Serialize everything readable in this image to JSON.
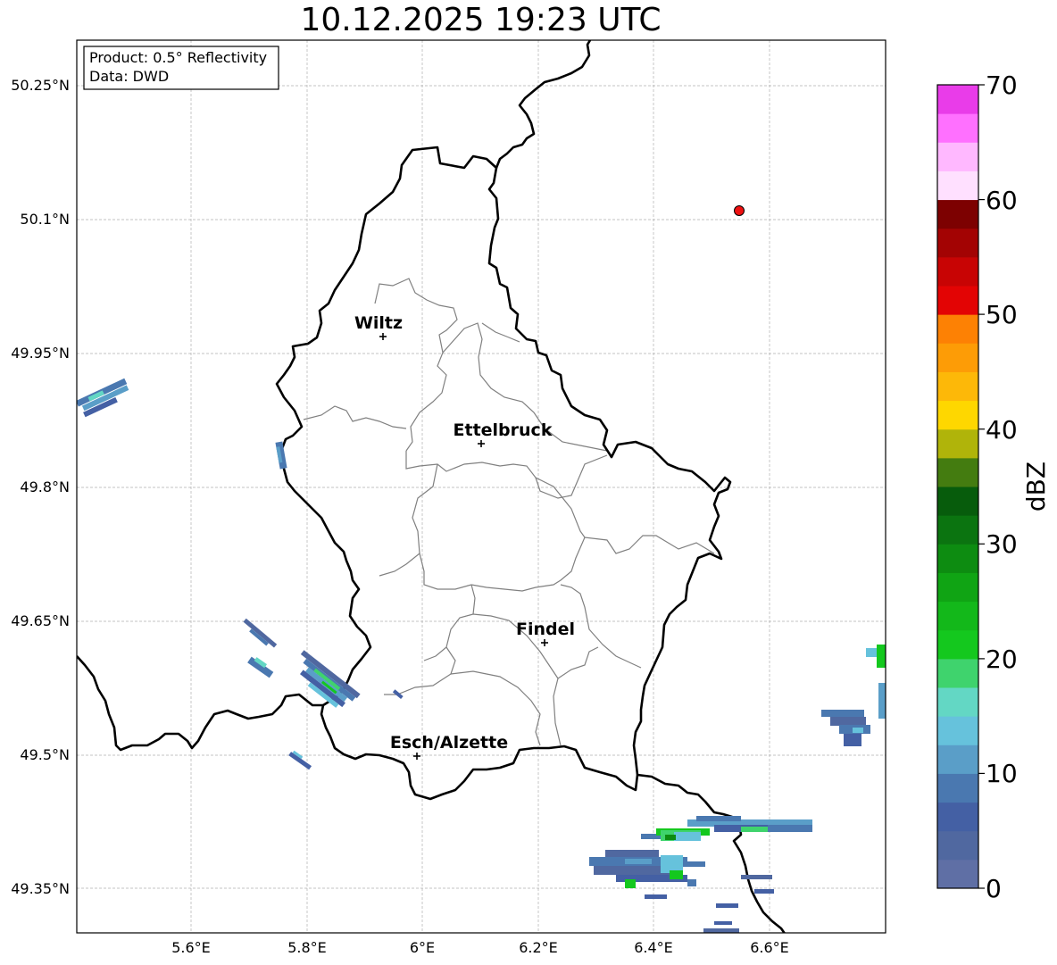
{
  "title": "10.12.2025 19:23 UTC",
  "info_box": {
    "product": "Product: 0.5° Reflectivity",
    "data": "Data: DWD"
  },
  "lat_labels": [
    "50.25°N",
    "50.1°N",
    "49.95°N",
    "49.8°N",
    "49.65°N",
    "49.5°N",
    "49.35°N"
  ],
  "lon_labels": [
    "5.6°E",
    "5.8°E",
    "6°E",
    "6.2°E",
    "6.4°E",
    "6.6°E"
  ],
  "cities": [
    {
      "name": "Wiltz"
    },
    {
      "name": "Ettelbruck"
    },
    {
      "name": "Findel"
    },
    {
      "name": "Esch/Alzette"
    }
  ],
  "colorbar": {
    "label": "dBZ",
    "ticks": [
      "0",
      "10",
      "20",
      "30",
      "40",
      "50",
      "60",
      "70"
    ],
    "colors": [
      "#5f6fa5",
      "#5068a0",
      "#4460a4",
      "#4a78b0",
      "#5a9ec8",
      "#66c2dc",
      "#63d7c4",
      "#3fd36d",
      "#14c81e",
      "#13b81a",
      "#10a414",
      "#0d8c11",
      "#0b7410",
      "#075c0c",
      "#447c10",
      "#b0b40a",
      "#fed700",
      "#fdb808",
      "#fd9c06",
      "#fd8104",
      "#e30404",
      "#c80404",
      "#a30303",
      "#7d0101",
      "#ffe0ff",
      "#ffb8ff",
      "#ff70ff",
      "#e93ce9"
    ]
  },
  "radar_site_color": "#ee1111"
}
